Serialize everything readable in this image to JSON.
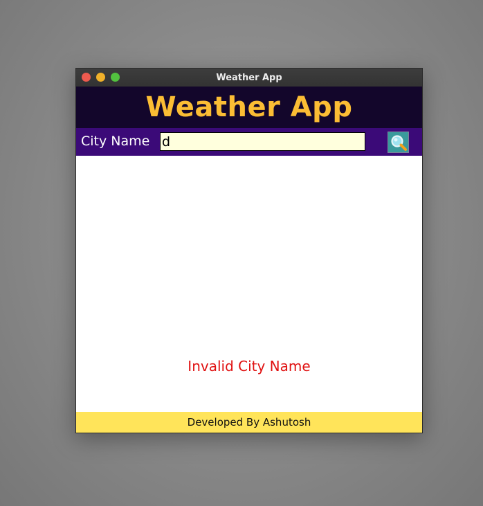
{
  "window": {
    "title": "Weather App",
    "controls": {
      "close_color": "#ee5a4f",
      "minimize_color": "#f0b02a",
      "maximize_color": "#52c13f"
    }
  },
  "header": {
    "title": "Weather App",
    "title_color": "#fbbd34",
    "background": "#13062b"
  },
  "search": {
    "label": "City Name",
    "value": "d",
    "input_background": "#ffffdd",
    "button_icon": "magnifier-icon"
  },
  "content": {
    "error_message": "Invalid City Name",
    "error_color": "#e01010"
  },
  "footer": {
    "text": "Developed By Ashutosh",
    "background": "#ffe45a"
  }
}
